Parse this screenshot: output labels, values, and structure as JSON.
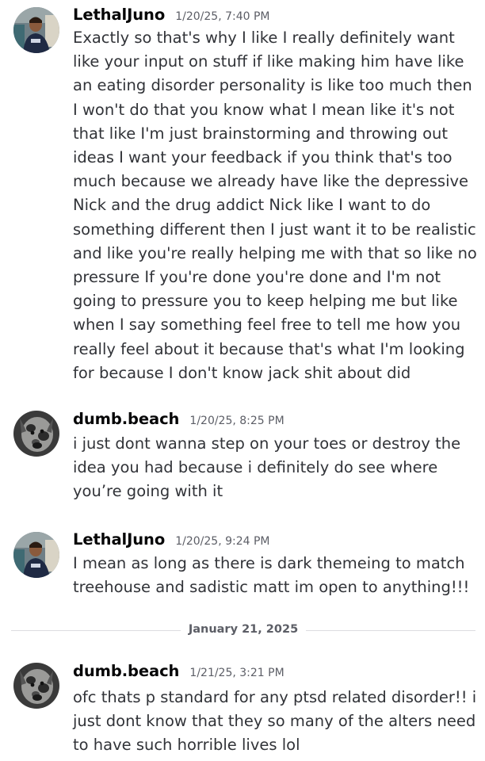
{
  "messages": [
    {
      "username": "LethalJuno",
      "timestamp": "1/20/25, 7:40 PM",
      "avatar": "lethaljuno-avatar",
      "lines": [
        "Exactly so that's why I like I really definitely want",
        "like your input on stuff if like making him have like",
        "an eating disorder personality is like too much then",
        "I won't do that you know what I mean like it's not",
        "that like I'm just brainstorming and throwing out",
        "ideas I want your feedback if you think that's too",
        "much because we already have like the depressive",
        "Nick and the drug addict Nick like I want to do",
        "something different then I just want it to be realistic",
        "and like you're really helping me with that so like no",
        "pressure If you're done you're done and I'm not",
        "going to pressure you to keep helping me but like",
        "when I say something feel free to tell me how you",
        "really feel about it because that's what I'm looking",
        "for because I don't know jack shit about did"
      ]
    },
    {
      "username": "dumb.beach",
      "timestamp": "1/20/25, 8:25 PM",
      "avatar": "dumbbeach-avatar",
      "lines": [
        "i just dont wanna step on your toes or destroy the",
        "idea you had because i definitely do see where",
        "you’re going with it"
      ]
    },
    {
      "username": "LethalJuno",
      "timestamp": "1/20/25, 9:24 PM",
      "avatar": "lethaljuno-avatar",
      "lines": [
        "I mean as long as there is dark themeing to match",
        "treehouse and sadistic matt im open to anything!!!"
      ]
    },
    {
      "username": "dumb.beach",
      "timestamp": "1/21/25, 3:21 PM",
      "avatar": "dumbbeach-avatar",
      "lines": [
        "ofc thats p standard for any ptsd related disorder!! i",
        "just dont know that they so many of the alters need",
        "to have such horrible lives lol"
      ]
    }
  ],
  "date_divider": "January 21, 2025",
  "colors": {
    "username": "#060607",
    "timestamp": "#5c5e66",
    "text": "#313338",
    "divider": "#dcdde0"
  }
}
